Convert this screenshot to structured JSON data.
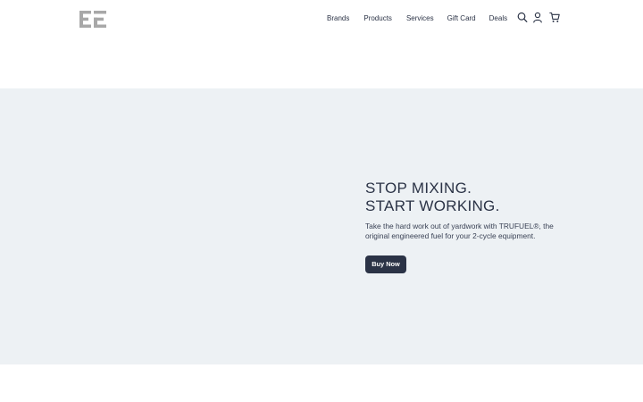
{
  "header": {
    "nav": [
      {
        "label": "Brands"
      },
      {
        "label": "Products"
      },
      {
        "label": "Services"
      },
      {
        "label": "Gift Card"
      },
      {
        "label": "Deals"
      }
    ],
    "icons": [
      "search-icon",
      "user-icon",
      "cart-icon"
    ]
  },
  "hero": {
    "title_line1": "STOP MIXING.",
    "title_line2": "START WORKING.",
    "description": "Take the hard work out of yardwork with TRUFUEL®, the original engineered fuel for your 2-cycle equipment.",
    "button_label": "Buy Now"
  },
  "colors": {
    "primary": "#2b3346",
    "hero_background": "#edf1f4",
    "logo_gray": "#a8a8a8"
  }
}
